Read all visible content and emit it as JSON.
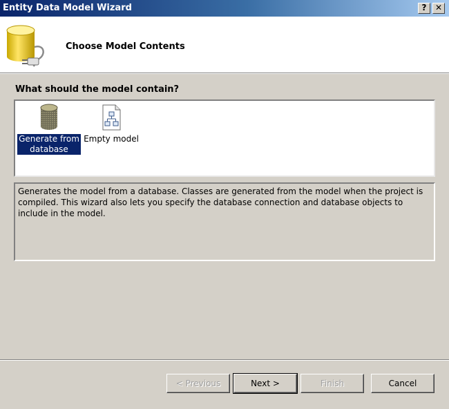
{
  "window": {
    "title": "Entity Data Model Wizard",
    "help_glyph": "?",
    "close_glyph": "✕"
  },
  "header": {
    "title": "Choose Model Contents",
    "icon": "database-plug-icon"
  },
  "main": {
    "question": "What should the model contain?",
    "options": [
      {
        "label": "Generate from database",
        "icon": "database-icon",
        "selected": true
      },
      {
        "label": "Empty model",
        "icon": "empty-model-icon",
        "selected": false
      }
    ],
    "description": "Generates the model from a database. Classes are generated from the model when the project is compiled. This wizard also lets you specify the database connection and database objects to include in the model."
  },
  "buttons": {
    "previous": {
      "label": "< Previous",
      "enabled": false
    },
    "next": {
      "label": "Next >",
      "enabled": true
    },
    "finish": {
      "label": "Finish",
      "enabled": false
    },
    "cancel": {
      "label": "Cancel",
      "enabled": true
    }
  },
  "colors": {
    "selection": "#0a246a",
    "dialog_bg": "#d4d0c8"
  }
}
